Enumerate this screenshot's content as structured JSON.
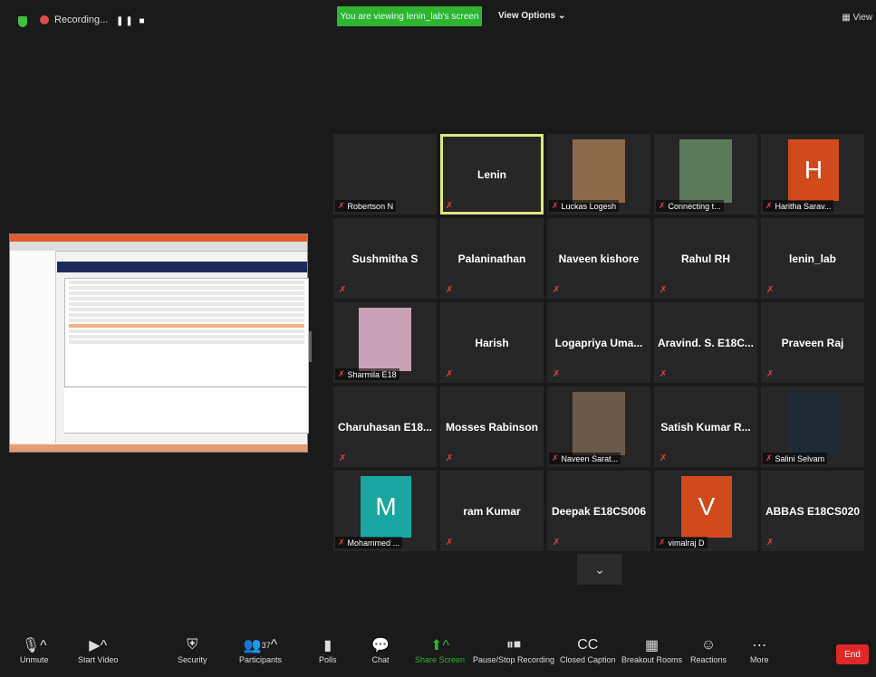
{
  "top": {
    "recording": "Recording...",
    "banner": "You are viewing lenin_lab's screen",
    "view_options": "View Options ⌄",
    "view": "View"
  },
  "grid": [
    {
      "name": "",
      "caption": "Robertson N",
      "kind": "blank"
    },
    {
      "name": "Lenin",
      "caption": "",
      "kind": "blank",
      "active": true
    },
    {
      "name": "",
      "caption": "Luckas Logesh",
      "kind": "photo",
      "photo_color": "#8a6a4a"
    },
    {
      "name": "",
      "caption": "Connecting t...",
      "kind": "photo",
      "photo_color": "#5a7a5a"
    },
    {
      "name": "",
      "caption": "Haritha Sarav...",
      "kind": "avatar",
      "letter": "H",
      "color": "#d14a1c"
    },
    {
      "name": "Sushmitha S",
      "caption": "",
      "kind": "blank"
    },
    {
      "name": "Palaninathan",
      "caption": "",
      "kind": "blank"
    },
    {
      "name": "Naveen kishore",
      "caption": "",
      "kind": "blank"
    },
    {
      "name": "Rahul RH",
      "caption": "",
      "kind": "blank"
    },
    {
      "name": "lenin_lab",
      "caption": "",
      "kind": "blank"
    },
    {
      "name": "",
      "caption": "Sharmila E18",
      "kind": "photo",
      "photo_color": "#c9a1b4"
    },
    {
      "name": "Harish",
      "caption": "",
      "kind": "blank"
    },
    {
      "name": "Logapriya Uma...",
      "caption": "",
      "kind": "blank"
    },
    {
      "name": "Aravind. S. E18C...",
      "caption": "",
      "kind": "blank"
    },
    {
      "name": "Praveen Raj",
      "caption": "",
      "kind": "blank"
    },
    {
      "name": "Charuhasan E18...",
      "caption": "",
      "kind": "blank"
    },
    {
      "name": "Mosses Rabinson",
      "caption": "",
      "kind": "blank"
    },
    {
      "name": "",
      "caption": "Naveen Sarat...",
      "kind": "photo",
      "photo_color": "#6b5a4a"
    },
    {
      "name": "Satish Kumar R...",
      "caption": "",
      "kind": "blank"
    },
    {
      "name": "",
      "caption": "Salini Selvam",
      "kind": "photo",
      "photo_color": "#1e2a36"
    },
    {
      "name": "",
      "caption": "Mohammed ...",
      "kind": "avatar",
      "letter": "M",
      "color": "#1aa6a0"
    },
    {
      "name": "ram Kumar",
      "caption": "",
      "kind": "blank"
    },
    {
      "name": "Deepak E18CS006",
      "caption": "",
      "kind": "blank"
    },
    {
      "name": "",
      "caption": "vimalraj D",
      "kind": "avatar",
      "letter": "V",
      "color": "#d14a1c"
    },
    {
      "name": "ABBAS E18CS020",
      "caption": "",
      "kind": "blank"
    }
  ],
  "toolbar": {
    "unmute": "Unmute",
    "start_video": "Start Video",
    "security": "Security",
    "participants": "Participants",
    "participants_count": "37",
    "polls": "Polls",
    "chat": "Chat",
    "share_screen": "Share Screen",
    "pause_stop": "Pause/Stop Recording",
    "closed_caption": "Closed Caption",
    "breakout": "Breakout Rooms",
    "reactions": "Reactions",
    "more": "More",
    "end": "End"
  }
}
